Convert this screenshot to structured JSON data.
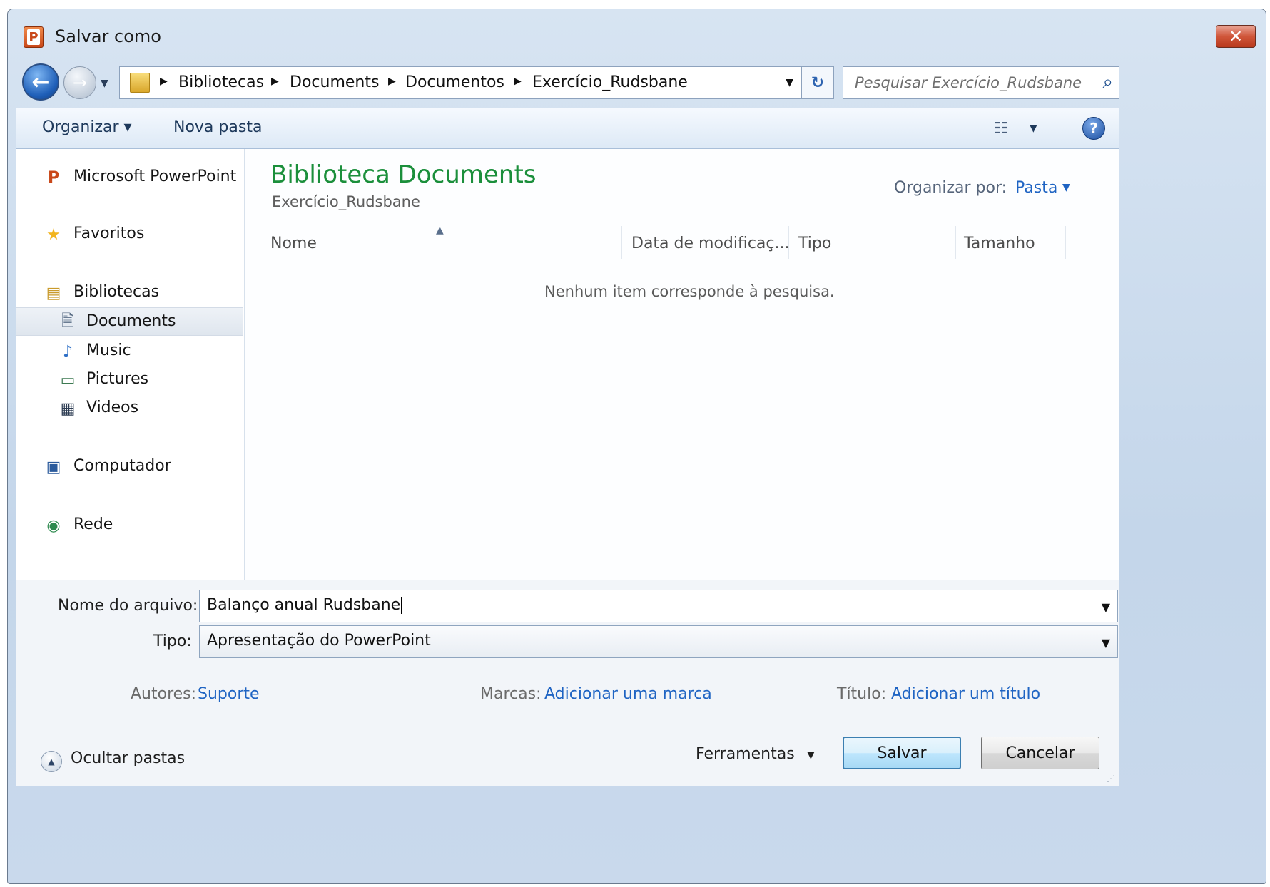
{
  "window": {
    "title": "Salvar como",
    "app_icon_letter": "P",
    "close_symbol": "✕"
  },
  "nav": {
    "back_symbol": "←",
    "forward_symbol": "→",
    "history_drop_symbol": "▼"
  },
  "address": {
    "crumbs": [
      "Bibliotecas",
      "Documents",
      "Documentos",
      "Exercício_Rudsbane"
    ],
    "separator": "▶",
    "drop_symbol": "▼",
    "refresh_symbol": "↻"
  },
  "search": {
    "placeholder": "Pesquisar Exercício_Rudsbane",
    "icon_symbol": "⌕"
  },
  "toolbar": {
    "organize_label": "Organizar ▾",
    "new_folder_label": "Nova pasta",
    "views_symbol": "☷",
    "views_drop_symbol": "▼",
    "help_symbol": "?"
  },
  "sidebar": {
    "items": [
      {
        "label": "Microsoft PowerPoint",
        "icon": "powerpoint-icon",
        "glyph": "P"
      },
      {
        "label": "Favoritos",
        "icon": "star-icon",
        "glyph": "★"
      },
      {
        "label": "Bibliotecas",
        "icon": "libraries-icon",
        "glyph": "▤"
      },
      {
        "label": "Documents",
        "icon": "document-icon",
        "glyph": "🗎"
      },
      {
        "label": "Music",
        "icon": "music-icon",
        "glyph": "♪"
      },
      {
        "label": "Pictures",
        "icon": "picture-icon",
        "glyph": "▭"
      },
      {
        "label": "Videos",
        "icon": "video-icon",
        "glyph": "▦"
      },
      {
        "label": "Computador",
        "icon": "computer-icon",
        "glyph": "▣"
      },
      {
        "label": "Rede",
        "icon": "network-icon",
        "glyph": "◉"
      }
    ],
    "selected": "Documents"
  },
  "content": {
    "title": "Biblioteca Documents",
    "subtitle": "Exercício_Rudsbane",
    "arrange_label": "Organizar por:",
    "arrange_value": "Pasta",
    "arrange_drop_symbol": "▼",
    "sort_symbol": "▲",
    "columns": [
      "Nome",
      "Data de modificaç...",
      "Tipo",
      "Tamanho"
    ],
    "empty_message": "Nenhum item corresponde à pesquisa."
  },
  "form": {
    "filename_label": "Nome do arquivo:",
    "filename_value": "Balanço anual Rudsbane",
    "type_label": "Tipo:",
    "type_value": "Apresentação do PowerPoint",
    "drop_symbol": "▼",
    "authors_label": "Autores:",
    "authors_value": "Suporte",
    "tags_label": "Marcas:",
    "tags_value": "Adicionar uma marca",
    "title_label": "Título:",
    "title_value": "Adicionar um título"
  },
  "footer": {
    "hide_symbol": "▲",
    "hide_folders_label": "Ocultar pastas",
    "tools_label": "Ferramentas",
    "tools_drop_symbol": "▼",
    "save_label": "Salvar",
    "cancel_label": "Cancelar",
    "grip_symbol": "⋰"
  }
}
